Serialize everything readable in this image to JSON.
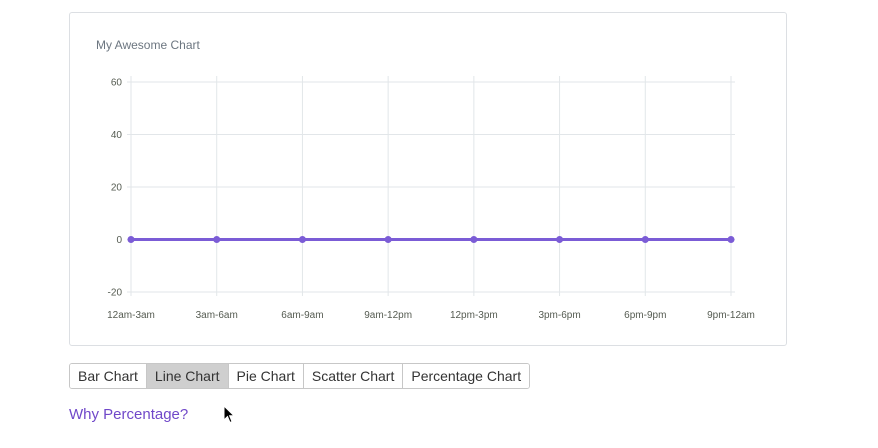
{
  "chart_data": {
    "type": "line",
    "title": "My Awesome Chart",
    "categories": [
      "12am-3am",
      "3am-6am",
      "6am-9am",
      "9am-12pm",
      "12pm-3pm",
      "3pm-6pm",
      "6pm-9pm",
      "9pm-12am"
    ],
    "series": [
      {
        "values": [
          0,
          0,
          0,
          0,
          0,
          0,
          0,
          0
        ]
      }
    ],
    "yticks": [
      60,
      40,
      20,
      0,
      -20
    ],
    "ylim": [
      -20,
      60
    ],
    "grid": true,
    "line_color": "#7b5cd6"
  },
  "buttons": [
    {
      "label": "Bar Chart",
      "active": false
    },
    {
      "label": "Line Chart",
      "active": true
    },
    {
      "label": "Pie Chart",
      "active": false
    },
    {
      "label": "Scatter Chart",
      "active": false
    },
    {
      "label": "Percentage Chart",
      "active": false
    }
  ],
  "link": {
    "label": "Why Percentage?",
    "color": "#7048c9"
  },
  "cursor": {
    "icon": "arrow-cursor-icon"
  }
}
